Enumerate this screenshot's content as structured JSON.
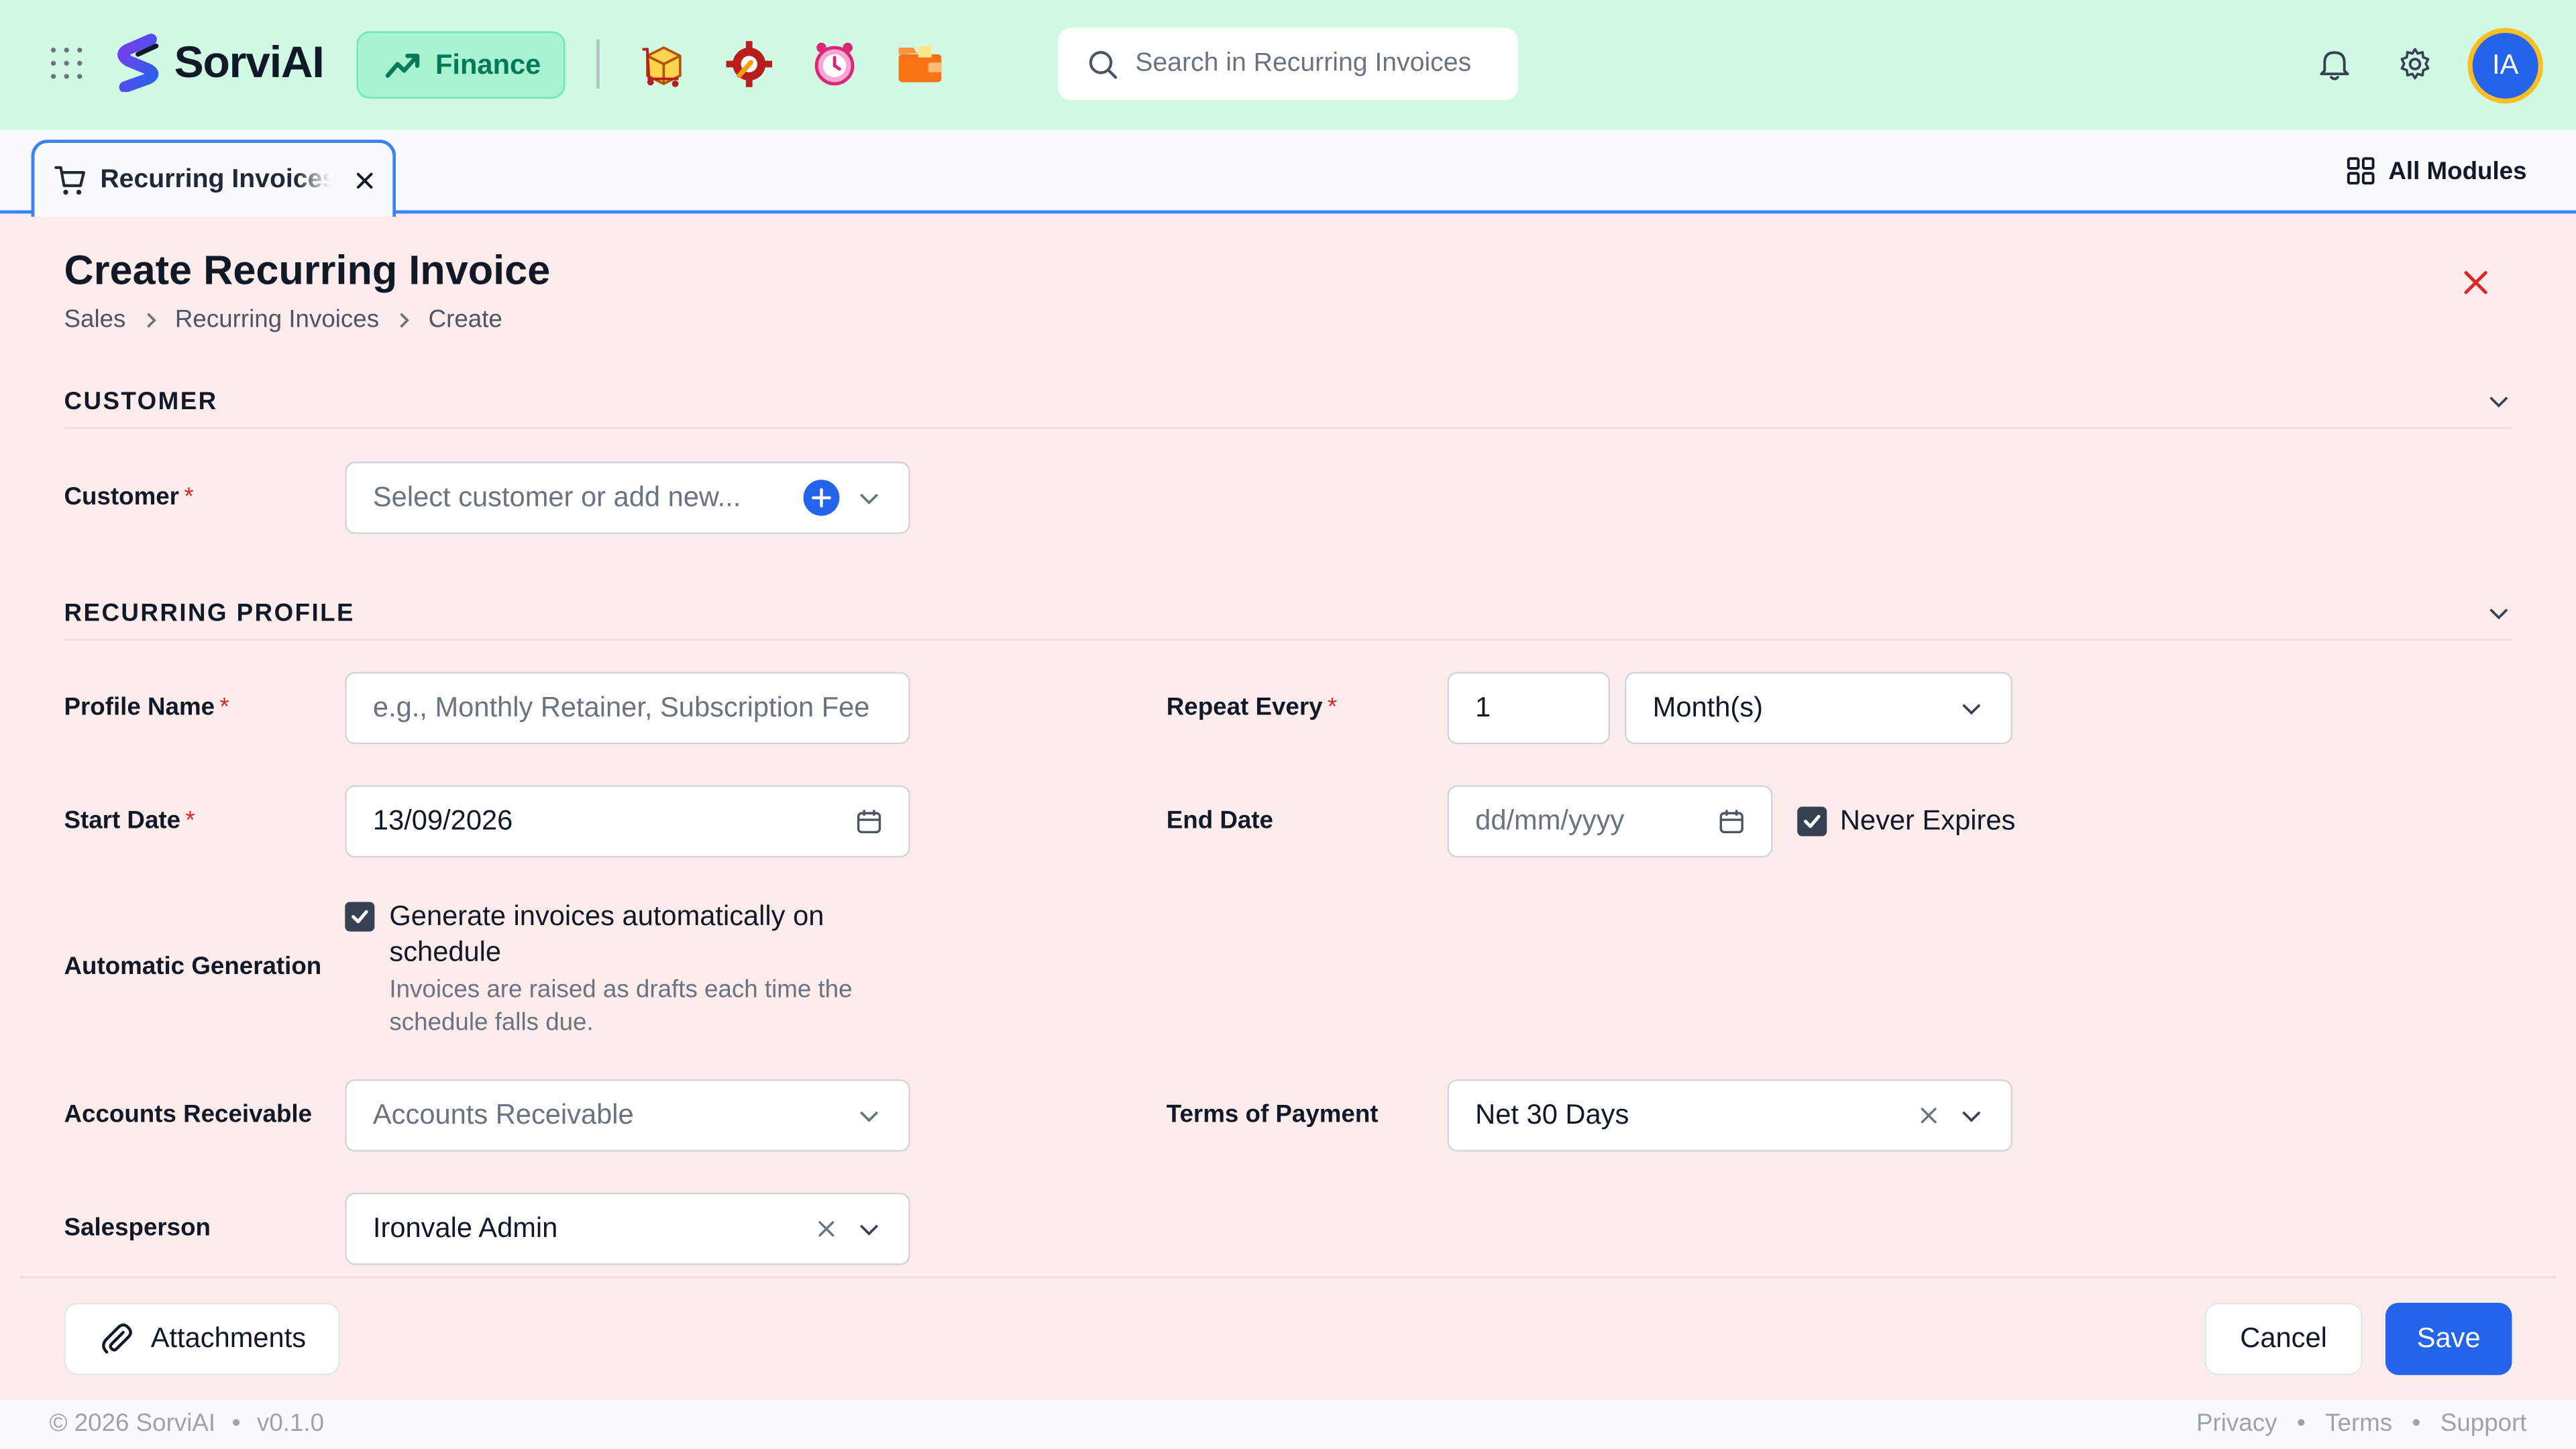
{
  "app": {
    "name": "SorviAI",
    "module": "Finance",
    "search_placeholder": "Search in Recurring Invoices",
    "avatar_initials": "IA",
    "accent_color": "#2563eb",
    "header_bg": "#d1fae5"
  },
  "tabs": {
    "active_label": "Recurring Invoices",
    "all_modules": "All Modules"
  },
  "page": {
    "title": "Create Recurring Invoice",
    "breadcrumb": [
      "Sales",
      "Recurring Invoices",
      "Create"
    ]
  },
  "sections": {
    "customer": {
      "title": "CUSTOMER",
      "customer_label": "Customer",
      "customer_placeholder": "Select customer or add new..."
    },
    "profile": {
      "title": "RECURRING PROFILE",
      "profile_name_label": "Profile Name",
      "profile_name_placeholder": "e.g., Monthly Retainer, Subscription Fee",
      "repeat_every_label": "Repeat Every",
      "repeat_every_value": "1",
      "repeat_unit": "Month(s)",
      "start_date_label": "Start Date",
      "start_date_value": "13/09/2026",
      "end_date_label": "End Date",
      "end_date_placeholder": "dd/mm/yyyy",
      "never_expires_label": "Never Expires",
      "never_expires_checked": true,
      "auto_gen_label": "Automatic Generation",
      "auto_gen_checkbox_label": "Generate invoices automatically on schedule",
      "auto_gen_checked": true,
      "auto_gen_hint": "Invoices are raised as drafts each time the schedule falls due.",
      "ar_label": "Accounts Receivable",
      "ar_placeholder": "Accounts Receivable",
      "terms_label": "Terms of Payment",
      "terms_value": "Net 30 Days",
      "salesperson_label": "Salesperson",
      "salesperson_value": "Ironvale Admin"
    }
  },
  "actions": {
    "attachments": "Attachments",
    "cancel": "Cancel",
    "save": "Save"
  },
  "footer": {
    "copyright": "© 2026 SorviAI",
    "version": "v0.1.0",
    "links": [
      "Privacy",
      "Terms",
      "Support"
    ]
  },
  "icons": {
    "grid": "app-grid-icon",
    "chart": "trending-up-icon",
    "search": "search-icon",
    "bell": "bell-icon",
    "gear": "gear-icon",
    "cart": "cart-icon",
    "close": "close-icon",
    "calendar": "calendar-icon",
    "chevron": "chevron-down-icon",
    "plus": "plus-circle-icon",
    "paperclip": "paperclip-icon"
  }
}
